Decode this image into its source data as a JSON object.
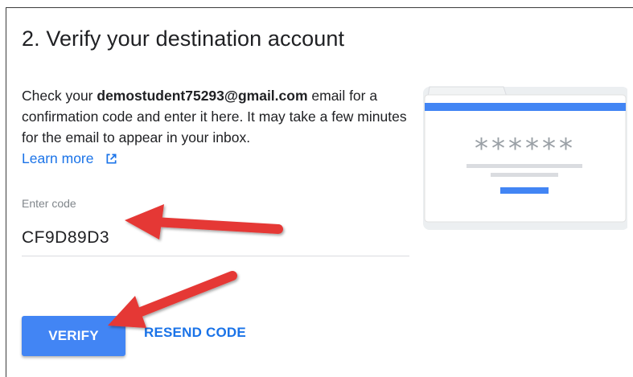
{
  "header": {
    "title": "2. Verify your destination account"
  },
  "description": {
    "prefix": "Check your ",
    "email": "demostudent75293@gmail.com",
    "suffix": " email for a confirmation code and enter it here. It may take a few minutes for the email to appear in your inbox.",
    "learn_more_label": "Learn more",
    "learn_more_icon": "open-in-new-icon"
  },
  "code_field": {
    "label": "Enter code",
    "value": "CF9D89D3"
  },
  "actions": {
    "verify_label": "VERIFY",
    "resend_label": "RESEND CODE"
  },
  "illustration": {
    "masked_text": "******"
  },
  "colors": {
    "accent_blue": "#4285f4",
    "link_blue": "#1a73e8",
    "annotation_red": "#e53935"
  }
}
